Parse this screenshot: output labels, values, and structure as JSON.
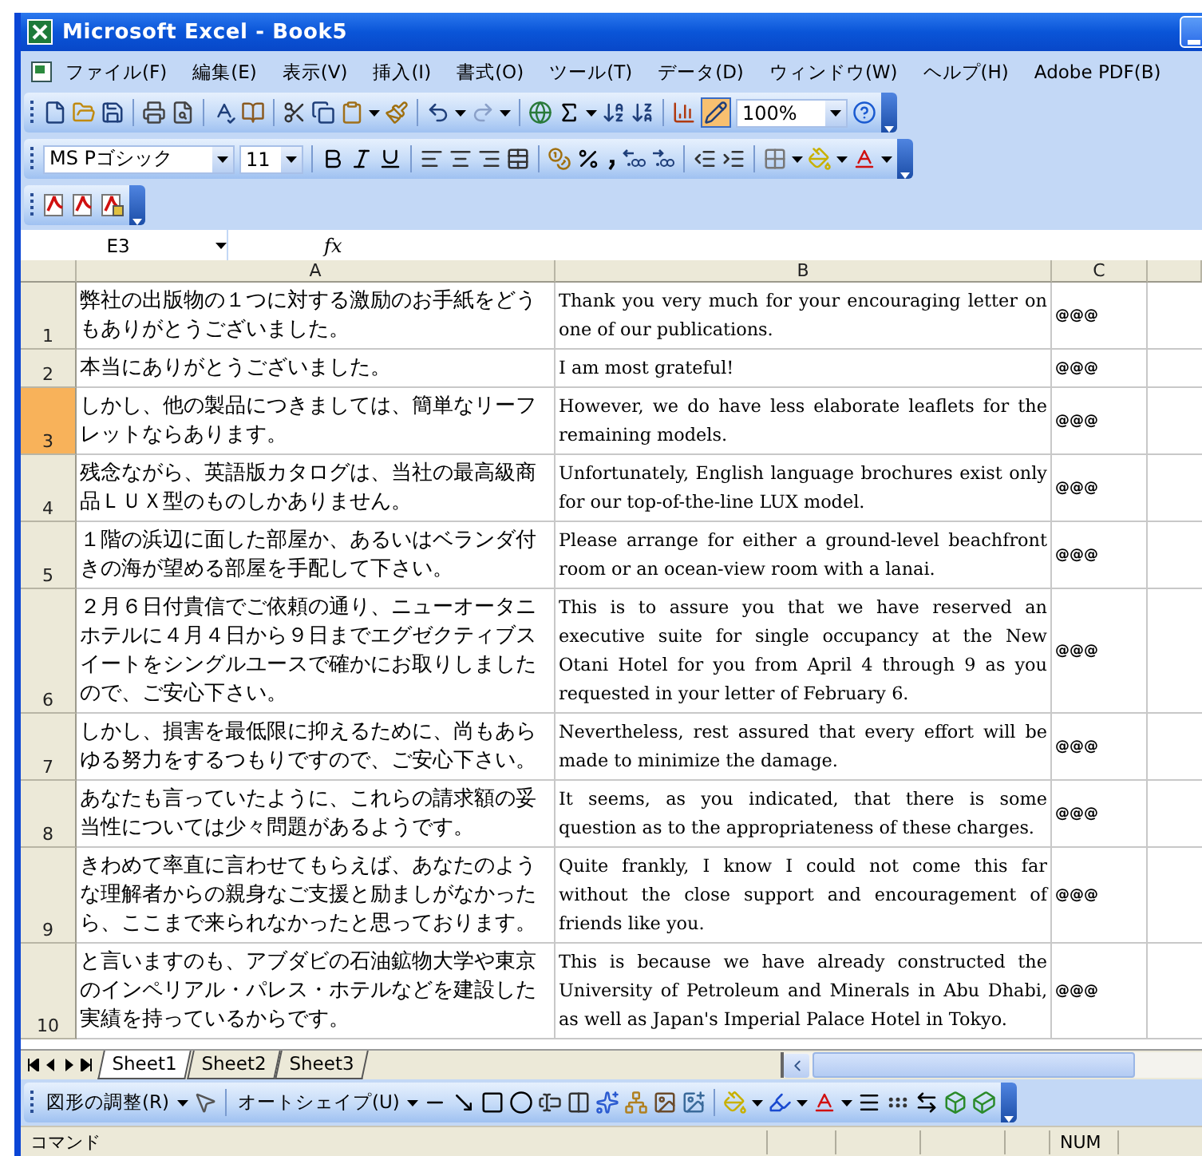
{
  "window": {
    "title": "Microsoft Excel - Book5"
  },
  "menu": [
    "ファイル(F)",
    "編集(E)",
    "表示(V)",
    "挿入(I)",
    "書式(O)",
    "ツール(T)",
    "データ(D)",
    "ウィンドウ(W)",
    "ヘルプ(H)",
    "Adobe PDF(B)"
  ],
  "standard_toolbar": {
    "zoom": "100%"
  },
  "formatting_toolbar": {
    "font": "MS Pゴシック",
    "size": "11"
  },
  "formula_bar": {
    "name_box": "E3",
    "function_label": "fx"
  },
  "columns": [
    {
      "label": "A"
    },
    {
      "label": "B"
    },
    {
      "label": "C"
    }
  ],
  "rows": [
    {
      "number": "1",
      "selected": false,
      "a": "弊社の出版物の１つに対する激励のお手紙をどうもありがとうございました。",
      "b": "Thank you very much for your encouraging letter on one of our publications.",
      "c": "@@@"
    },
    {
      "number": "2",
      "selected": false,
      "a": "本当にありがとうございました。",
      "b": "I am most grateful!",
      "c": "@@@"
    },
    {
      "number": "3",
      "selected": true,
      "a": "しかし、他の製品につきましては、簡単なリーフレットならあります。",
      "b": "However, we do have less elaborate leaflets for the remaining models.",
      "c": "@@@"
    },
    {
      "number": "4",
      "selected": false,
      "a": "残念ながら、英語版カタログは、当社の最高級商品ＬＵＸ型のものしかありません。",
      "b": "Unfortunately, English language brochures exist only for our top-of-the-line LUX model.",
      "c": "@@@"
    },
    {
      "number": "5",
      "selected": false,
      "a": "１階の浜辺に面した部屋か、あるいはベランダ付きの海が望める部屋を手配して下さい。",
      "b": "Please arrange for either a ground-level beachfront room or an ocean-view room with a lanai.",
      "c": "@@@"
    },
    {
      "number": "6",
      "selected": false,
      "a": "２月６日付貴信でご依頼の通り、ニューオータニホテルに４月４日から９日までエグゼクティブスイートをシングルユースで確かにお取りしましたので、ご安心下さい。",
      "b": "This is to assure you that we have reserved an executive suite for single occupancy at the New Otani Hotel for you from April 4 through 9 as you requested in your letter of February 6.",
      "c": "@@@"
    },
    {
      "number": "7",
      "selected": false,
      "a": "しかし、損害を最低限に抑えるために、尚もあらゆる努力をするつもりですので、ご安心下さい。",
      "b": "Nevertheless, rest assured that every effort will be made to minimize the damage.",
      "c": "@@@"
    },
    {
      "number": "8",
      "selected": false,
      "a": "あなたも言っていたように、これらの請求額の妥当性については少々問題があるようです。",
      "b": "It seems, as you indicated, that there is some question as to the appropriateness of these charges.",
      "c": "@@@"
    },
    {
      "number": "9",
      "selected": false,
      "a": "きわめて率直に言わせてもらえば、あなたのような理解者からの親身なご支援と励ましがなかったら、ここまで来られなかったと思っております。",
      "b": "Quite frankly, I know I could not come this far without the close support and encouragement of friends like you.",
      "c": "@@@"
    },
    {
      "number": "10",
      "selected": false,
      "a": "と言いますのも、アブダビの石油鉱物大学や東京のインペリアル・パレス・ホテルなどを建設した実績を持っているからです。",
      "b": "This is because we have already constructed the University of Petroleum and Minerals in Abu Dhabi, as well as Japan's Imperial Palace Hotel in Tokyo.",
      "c": "@@@"
    }
  ],
  "sheet_tabs": [
    {
      "label": "Sheet1",
      "selected": true
    },
    {
      "label": "Sheet2",
      "selected": false
    },
    {
      "label": "Sheet3",
      "selected": false
    }
  ],
  "drawing_toolbar": {
    "draw_menu": "図形の調整(R)",
    "autoshapes_menu": "オートシェイプ(U)"
  },
  "status_bar": {
    "mode": "コマンド",
    "indicator": "NUM"
  }
}
